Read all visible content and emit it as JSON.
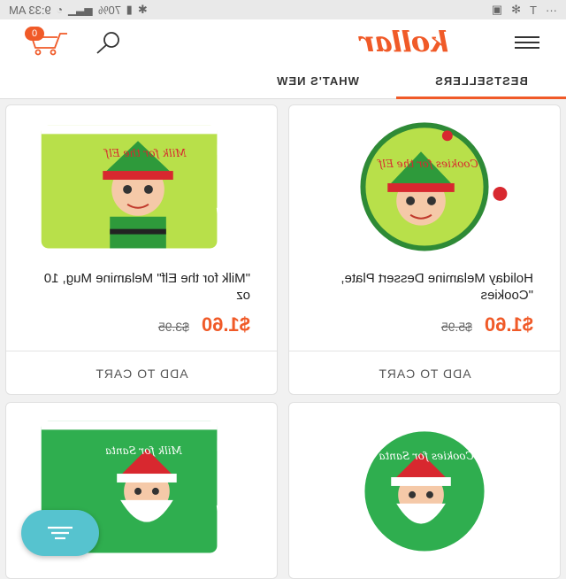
{
  "statusbar": {
    "time": "9:33 AM",
    "battery": "70%",
    "icons": [
      "wifi-icon",
      "bluetooth-icon",
      "battery-icon",
      "signal-icon",
      "overflow-dots-icon",
      "T",
      "fan-icon",
      "image-icon"
    ]
  },
  "header": {
    "cart_count": "0",
    "logo": "kollar"
  },
  "tabs": [
    {
      "label": "BESTSELLERS",
      "active": true
    },
    {
      "label": "WHAT'S NEW",
      "active": false
    }
  ],
  "products": [
    {
      "title": "Holiday Melamine Dessert Plate, \"Cookies",
      "price": "$1.60",
      "old_price": "$5.95",
      "cta": "ADD TO CART",
      "image": "plate-elf"
    },
    {
      "title": "\"Milk for the Elf\" Melamine Mug, 10 oz",
      "price": "$1.60",
      "old_price": "$3.95",
      "cta": "ADD TO CART",
      "image": "mug-elf"
    },
    {
      "title": "",
      "price": "",
      "old_price": "",
      "cta": "",
      "image": "plate-santa"
    },
    {
      "title": "",
      "price": "",
      "old_price": "",
      "cta": "",
      "image": "mug-santa"
    }
  ],
  "image_text": {
    "plate_elf": "Cookies for the Elf",
    "mug_elf": "Milk for the Elf",
    "plate_santa": "Cookies for Santa",
    "mug_santa": "Milk for Santa"
  },
  "colors": {
    "accent": "#f05a28",
    "fab": "#56c3cf"
  }
}
